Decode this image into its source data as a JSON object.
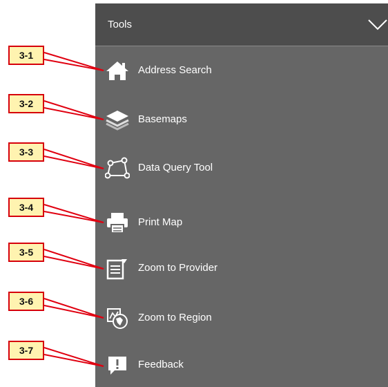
{
  "panel": {
    "title": "Tools",
    "collapse_icon": "chevron-down-icon",
    "colors": {
      "header_bg": "#4d4d4d",
      "body_bg": "#666666",
      "text": "#ffffff"
    }
  },
  "tools": [
    {
      "label": "Address Search",
      "icon": "home-icon",
      "callout": "3-1"
    },
    {
      "label": "Basemaps",
      "icon": "layers-icon",
      "callout": "3-2"
    },
    {
      "label": "Data Query Tool",
      "icon": "polygon-select-icon",
      "callout": "3-3"
    },
    {
      "label": "Print Map",
      "icon": "printer-icon",
      "callout": "3-4"
    },
    {
      "label": "Zoom to Provider",
      "icon": "zoom-provider-icon",
      "callout": "3-5"
    },
    {
      "label": "Zoom to Region",
      "icon": "zoom-region-icon",
      "callout": "3-6"
    },
    {
      "label": "Feedback",
      "icon": "feedback-icon",
      "callout": "3-7"
    }
  ],
  "callout_colors": {
    "border": "#d6000a",
    "fill": "#fff3b0",
    "arrow": "#e00010"
  }
}
